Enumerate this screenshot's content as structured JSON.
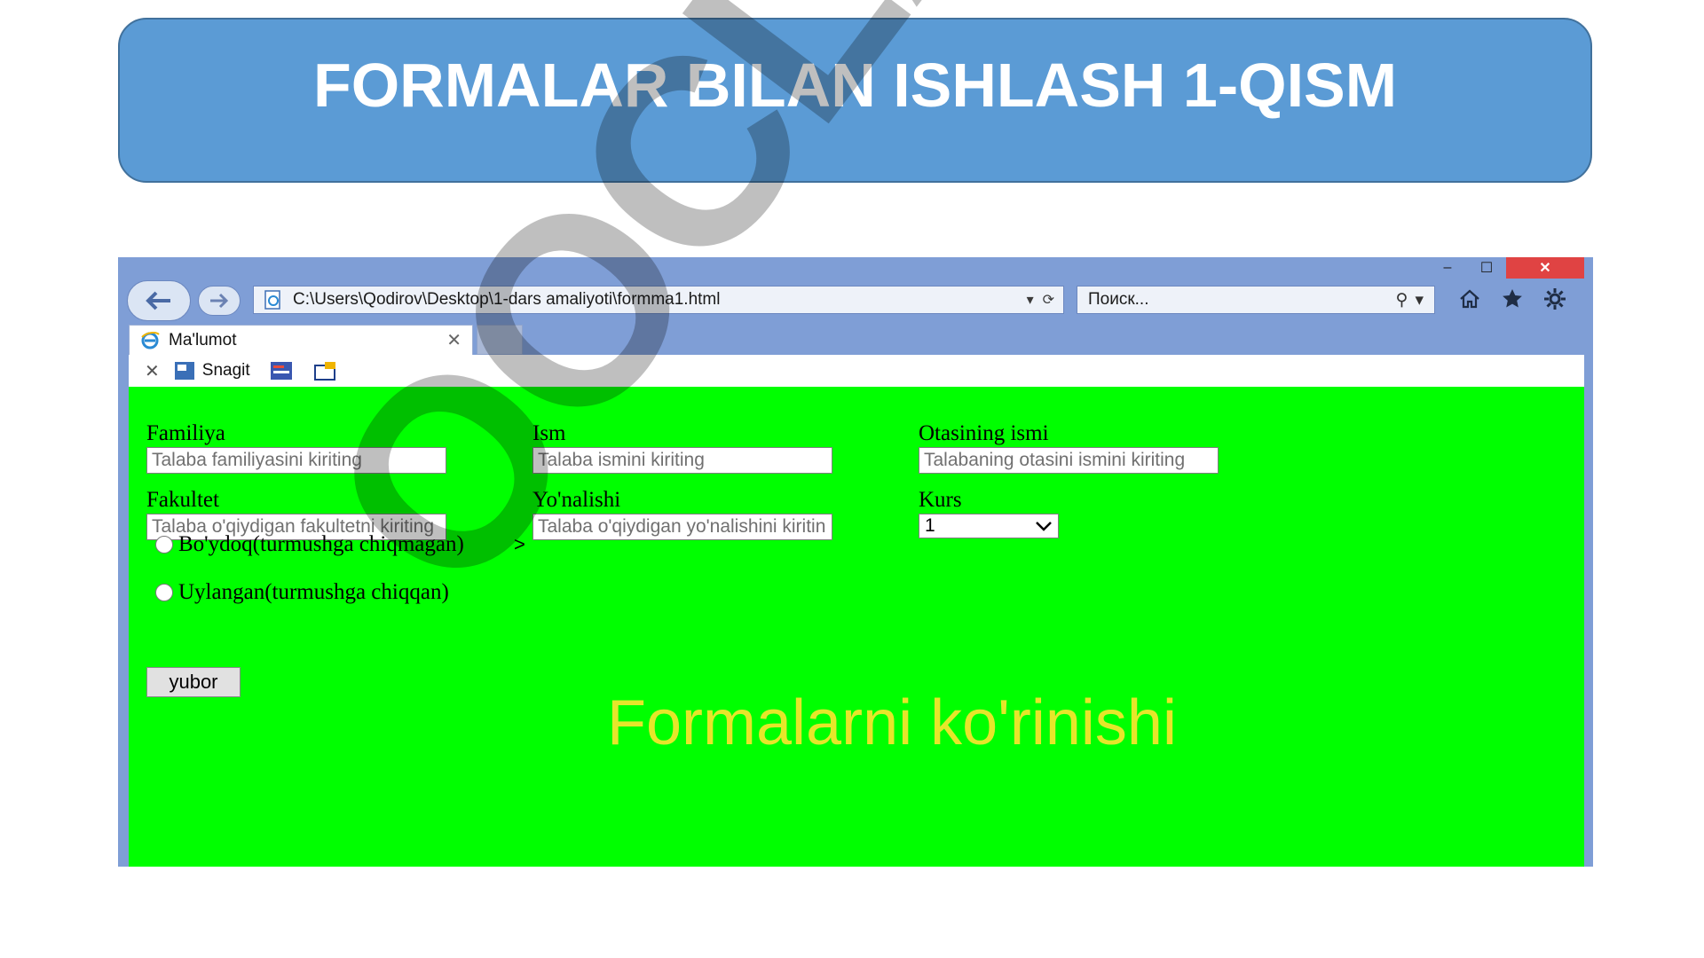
{
  "slide": {
    "title": "FORMALAR BILAN ISHLASH 1-QISM"
  },
  "browser": {
    "window_controls": {
      "minimize": "–",
      "maximize": "☐",
      "close": "✕"
    },
    "address": "C:\\Users\\Qodirov\\Desktop\\1-dars amaliyoti\\formma1.html",
    "search_placeholder": "Поиск...",
    "tab_title": "Ma'lumot",
    "command_bar": {
      "snagit_label": "Snagit"
    }
  },
  "form": {
    "familiya": {
      "label": "Familiya",
      "placeholder": "Talaba familiyasini kiriting"
    },
    "ism": {
      "label": "Ism",
      "placeholder": "Talaba ismini kiriting"
    },
    "otasining_ismi": {
      "label": "Otasining ismi",
      "placeholder": "Talabaning otasini ismini kiriting"
    },
    "fakultet": {
      "label": "Fakultet",
      "placeholder": "Talaba o'qiydigan fakultetni kiriting",
      "trailing_char": ">"
    },
    "yonalishi": {
      "label": "Yo'nalishi",
      "placeholder": "Talaba o'qiydigan yo'nalishini  kiritin"
    },
    "kurs": {
      "label": "Kurs",
      "selected": "1"
    },
    "radios": [
      {
        "label": "Bo'ydoq(turmushga chiqmagan)"
      },
      {
        "label": "Uylangan(turmushga chiqqan)"
      }
    ],
    "submit_label": "yubor",
    "heading": "Formalarni ko'rinishi"
  },
  "watermark": {
    "text": "OOCLAB.U"
  },
  "colors": {
    "banner": "#5b9bd5",
    "page_bg": "#00ff00",
    "heading": "#e6e62a",
    "close_btn": "#e04343"
  }
}
